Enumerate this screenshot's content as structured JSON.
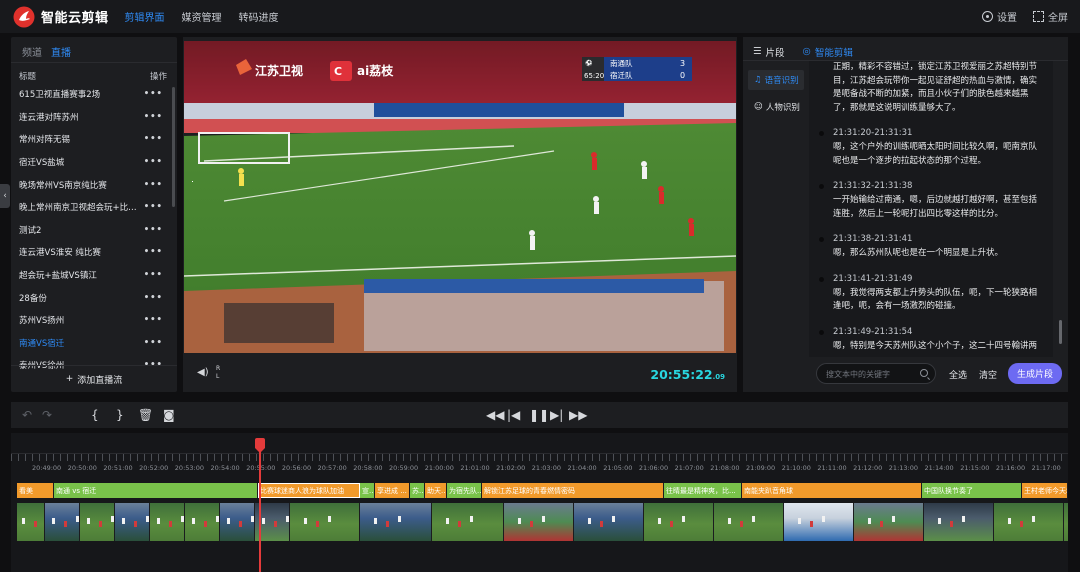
{
  "app": {
    "title": "智能云剪辑"
  },
  "nav": [
    "剪辑界面",
    "媒资管理",
    "转码进度"
  ],
  "topright": {
    "settings": "设置",
    "fullscreen": "全屏"
  },
  "left": {
    "tabs": [
      "频道",
      "直播"
    ],
    "col_title": "标题",
    "col_action": "操作",
    "items": [
      "615卫视直播赛事2场",
      "连云港对阵苏州",
      "常州对阵无锡",
      "宿迁VS盐城",
      "晚场常州VS南京纯比赛",
      "晚上常州南京卫视超会玩+比赛...",
      "测试2",
      "连云港VS淮安 纯比赛",
      "超会玩+盐城VS镇江",
      "28备份",
      "苏州VS扬州",
      "南通VS宿迁",
      "泰州VS徐州"
    ],
    "more": "•••",
    "add": "添加直播流"
  },
  "video": {
    "timecode": "20:55:22",
    "frames": ".09",
    "rl": [
      "R",
      "L"
    ],
    "overlay_channel": "江苏卫视",
    "overlay_brand": "ai荔枝",
    "score_time": "65:20",
    "team1": "南通队",
    "score1": "3",
    "team2": "宿迁队",
    "score2": "0"
  },
  "right": {
    "tabs": [
      "片段",
      "智能剪辑"
    ],
    "side": [
      "语音识别",
      "人物识别"
    ],
    "first_text": "正期，精彩不容错过，锁定江苏卫视爱丽之苏超特别节目，江苏超会玩带你一起见证舒超的热血与激情，确实是呃备战不断的加紧，而且小伙子们的肤色越来越黑了，那就是这说明训练量够大了。",
    "entries": [
      {
        "time": "21:31:20-21:31:31",
        "text": "嗯，这个户外的训练呃晒太阳时间比较久啊，呃南京队呢也是一个逐步的拉起状态的那个过程。"
      },
      {
        "time": "21:31:32-21:31:38",
        "text": "一开始输给过南通，嗯，后边就越打越好啊，甚至包括连胜，然后上一轮呢打出四比零这样的比分。"
      },
      {
        "time": "21:31:38-21:31:41",
        "text": "嗯，那么苏州队呢也是在一个明显是上升状。"
      },
      {
        "time": "21:31:41-21:31:49",
        "text": "嗯，我觉得两支都上升势头的队伍，呃，下一轮狭路相逢吧，呃，会有一场激烈的碰撞。"
      },
      {
        "time": "21:31:49-21:31:54",
        "text": "嗯，特别是今天苏州队这个小个子，这二十四号翰讲两"
      }
    ],
    "search_placeholder": "搜文本中的关键字",
    "select_all": "全选",
    "clear": "清空",
    "generate": "生成片段"
  },
  "toolbar": {
    "brace_open": "{",
    "brace_close": "}"
  },
  "ruler": [
    "20:49:00",
    "20:50:00",
    "20:51:00",
    "20:52:00",
    "20:53:00",
    "20:54:00",
    "20:55:00",
    "20:56:00",
    "20:57:00",
    "20:58:00",
    "20:59:00",
    "21:00:00",
    "21:01:00",
    "21:02:00",
    "21:03:00",
    "21:04:00",
    "21:05:00",
    "21:06:00",
    "21:07:00",
    "21:08:00",
    "21:09:00",
    "21:10:00",
    "21:11:00",
    "21:12:00",
    "21:13:00",
    "21:14:00",
    "21:15:00",
    "21:16:00",
    "21:17:00"
  ],
  "clips": [
    {
      "label": "看美",
      "color": "o"
    },
    {
      "label": "南通 vs 宿迁",
      "color": "g"
    },
    {
      "label": "比赛球迷商人浪为球队加油",
      "color": "o"
    },
    {
      "label": "宣...",
      "color": "g"
    },
    {
      "label": "享进成 ...",
      "color": "o"
    },
    {
      "label": "苏...",
      "color": "g"
    },
    {
      "label": "助天...",
      "color": "o"
    },
    {
      "label": "为宿先队...",
      "color": "g"
    },
    {
      "label": "解锁江苏足球的青春燃情密码",
      "color": "o"
    },
    {
      "label": "往睛最是精神爽，比...",
      "color": "g"
    },
    {
      "label": "南能夹趴音角球",
      "color": "o"
    },
    {
      "label": "中国队换节奏了",
      "color": "g"
    },
    {
      "label": "王村老师今天和",
      "color": "o"
    }
  ]
}
